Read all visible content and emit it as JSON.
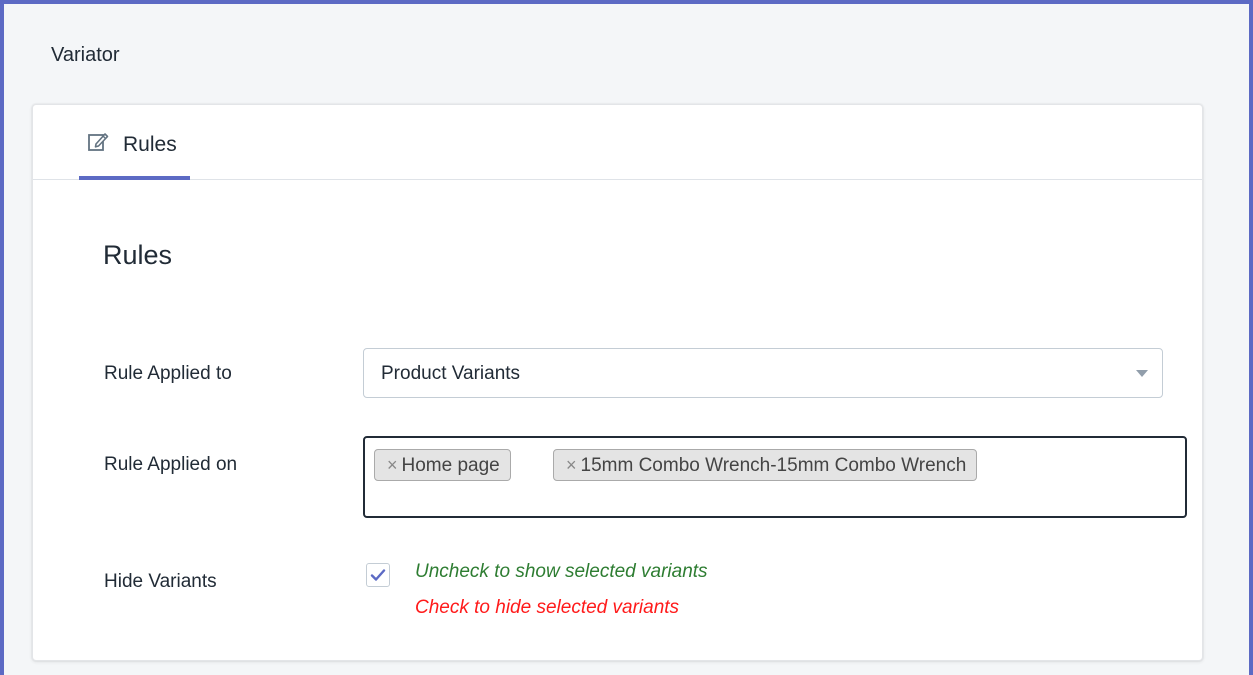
{
  "app": {
    "title": "Variator"
  },
  "tabs": [
    {
      "label": "Rules",
      "icon": "edit-icon",
      "active": true
    }
  ],
  "main": {
    "section_title": "Rules",
    "rule_applied_to": {
      "label": "Rule Applied to",
      "selected": "Product Variants"
    },
    "rule_applied_on": {
      "label": "Rule Applied on",
      "chips": [
        {
          "label": "Home page",
          "remove_glyph": "×"
        },
        {
          "label": "15mm Combo Wrench-15mm Combo Wrench",
          "remove_glyph": "×"
        }
      ]
    },
    "hide_variants": {
      "label": "Hide Variants",
      "checked": true,
      "hint_uncheck": "Uncheck to show selected variants",
      "hint_check": "Check to hide selected variants"
    }
  },
  "colors": {
    "accent": "#5c6ac4",
    "hint_green": "#2e7d32",
    "hint_red": "#ff1a1a",
    "checkmark": "#5c6ac4"
  }
}
